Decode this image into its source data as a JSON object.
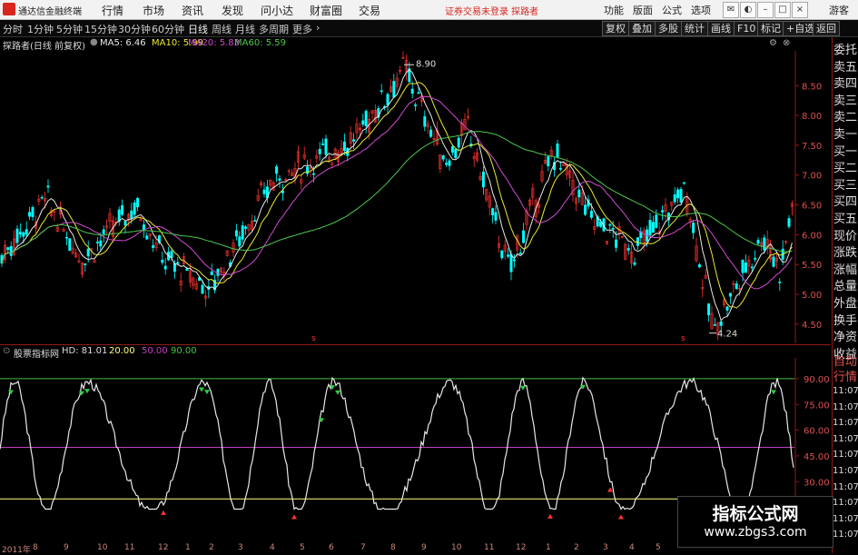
{
  "app": {
    "name": "通达信金融终端"
  },
  "menu": [
    "行情",
    "市场",
    "资讯",
    "发现",
    "问小达",
    "财富圈",
    "交易"
  ],
  "login_warning": "证券交易未登录  探路者",
  "right_menu": [
    "功能",
    "版面",
    "公式",
    "选项"
  ],
  "user": "游客",
  "timeframes": [
    "分时",
    "1分钟",
    "5分钟",
    "15分钟",
    "30分钟",
    "60分钟",
    "日线",
    "周线",
    "月线",
    "多周期",
    "更多"
  ],
  "active_timeframe": "日线",
  "tools": [
    "复权",
    "叠加",
    "多股",
    "统计",
    "画线",
    "F10",
    "标记",
    "+自选",
    "返回"
  ],
  "price": {
    "stock": "探路者(日线 前复权)",
    "ma": [
      {
        "label": "MA5: 6.46",
        "color": "#e8e8e8"
      },
      {
        "label": "MA10: 5.99",
        "color": "#e8e832"
      },
      {
        "label": "MA20: 5.83",
        "color": "#d24bd2"
      },
      {
        "label": "MA60: 5.59",
        "color": "#4ec84e"
      }
    ],
    "ylim": [
      4.3,
      8.9
    ],
    "ticks": [
      "8.50",
      "8.00",
      "7.50",
      "7.00",
      "6.50",
      "6.00",
      "5.50",
      "5.00",
      "4.50"
    ],
    "high_label": "8.90",
    "low_label": "4.24",
    "markers": [
      "s",
      "s"
    ]
  },
  "indicator": {
    "title": "股票指标网",
    "hd": "HD: 81.01",
    "levels": [
      {
        "label": "20.00",
        "value": 20,
        "color": "#ffff80"
      },
      {
        "label": "50.00",
        "value": 50,
        "color": "#c040c0"
      },
      {
        "label": "90.00",
        "value": 90,
        "color": "#40c040"
      }
    ],
    "ylim": [
      0,
      100
    ],
    "ticks": [
      "90.00",
      "75.00",
      "60.00",
      "45.00",
      "30.00"
    ]
  },
  "dates": [
    "2011年",
    "8",
    "9",
    "10",
    "11",
    "12",
    "1",
    "2",
    "3",
    "4",
    "5",
    "6",
    "7",
    "8",
    "9",
    "10",
    "11",
    "12",
    "1",
    "2",
    "3",
    "4",
    "5"
  ],
  "side_panel": {
    "quote_items": [
      "委托",
      "卖五",
      "卖四",
      "卖三",
      "卖二",
      "卖一",
      "买一",
      "买二",
      "买三",
      "买四",
      "买五",
      "现价",
      "涨跌",
      "涨幅",
      "总量",
      "外盘",
      "换手",
      "净资",
      "收益"
    ],
    "lower": [
      "自动",
      "行情"
    ],
    "times": [
      "11:07",
      "11:07",
      "11:07",
      "11:07",
      "11:07",
      "11:07",
      "11:07",
      "11:07",
      "11:07",
      "11:07"
    ]
  },
  "watermark": {
    "title": "指标公式网",
    "url": "www.zbgs3.com"
  },
  "colors": {
    "up": "#ff3232",
    "down": "#00ffff",
    "frame": "#8b1a1a",
    "axis_text": "#e05050"
  }
}
